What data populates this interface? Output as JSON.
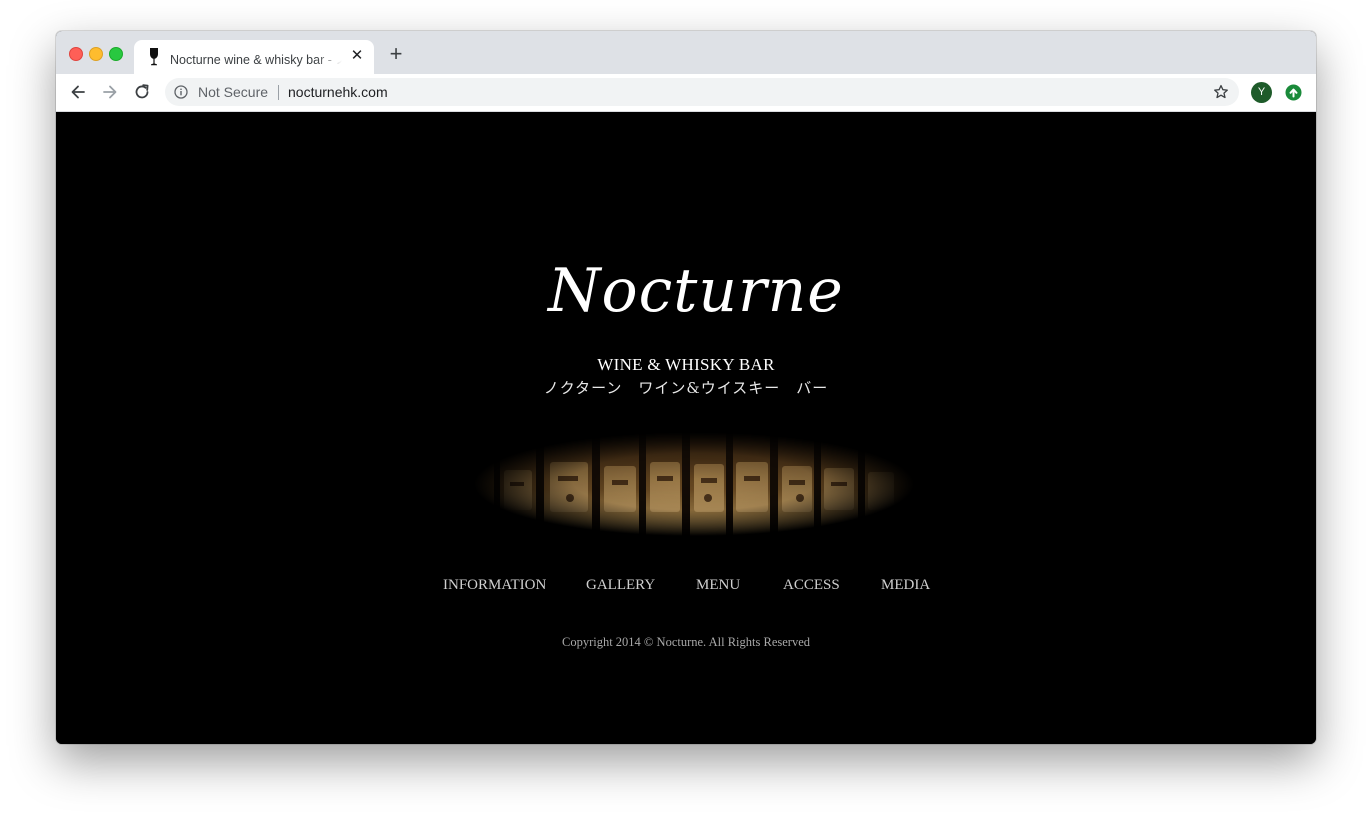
{
  "browser": {
    "tab": {
      "title": "Nocturne wine & whisky bar - ノクターン",
      "close_glyph": "✕"
    },
    "new_tab_glyph": "+",
    "security_label": "Not Secure",
    "url": "nocturnehk.com",
    "profile_initial": "Y",
    "icons": {
      "favicon": "wine-glass-icon",
      "back": "arrow-left-icon",
      "forward": "arrow-right-icon",
      "reload": "reload-icon",
      "info": "info-icon",
      "bookmark": "star-icon",
      "update": "arrow-up-circle-icon"
    },
    "colors": {
      "profile_avatar": "#1e5b2a",
      "update_icon": "#1a8a3a"
    }
  },
  "page": {
    "logo_text": "Nocturne",
    "subtitle_en": "WINE & WHISKY BAR",
    "subtitle_jp": "ノクターン　ワイン&ウイスキー　バー",
    "hero_image": "whisky-bottles-image",
    "nav": [
      {
        "label": "INFORMATION"
      },
      {
        "label": "GALLERY"
      },
      {
        "label": "MENU"
      },
      {
        "label": "ACCESS"
      },
      {
        "label": "MEDIA"
      }
    ],
    "copyright": "Copyright 2014 © Nocturne. All Rights Reserved",
    "colors": {
      "background": "#000000",
      "text": "#ffffff",
      "nav_text": "#cfcfcf"
    }
  }
}
